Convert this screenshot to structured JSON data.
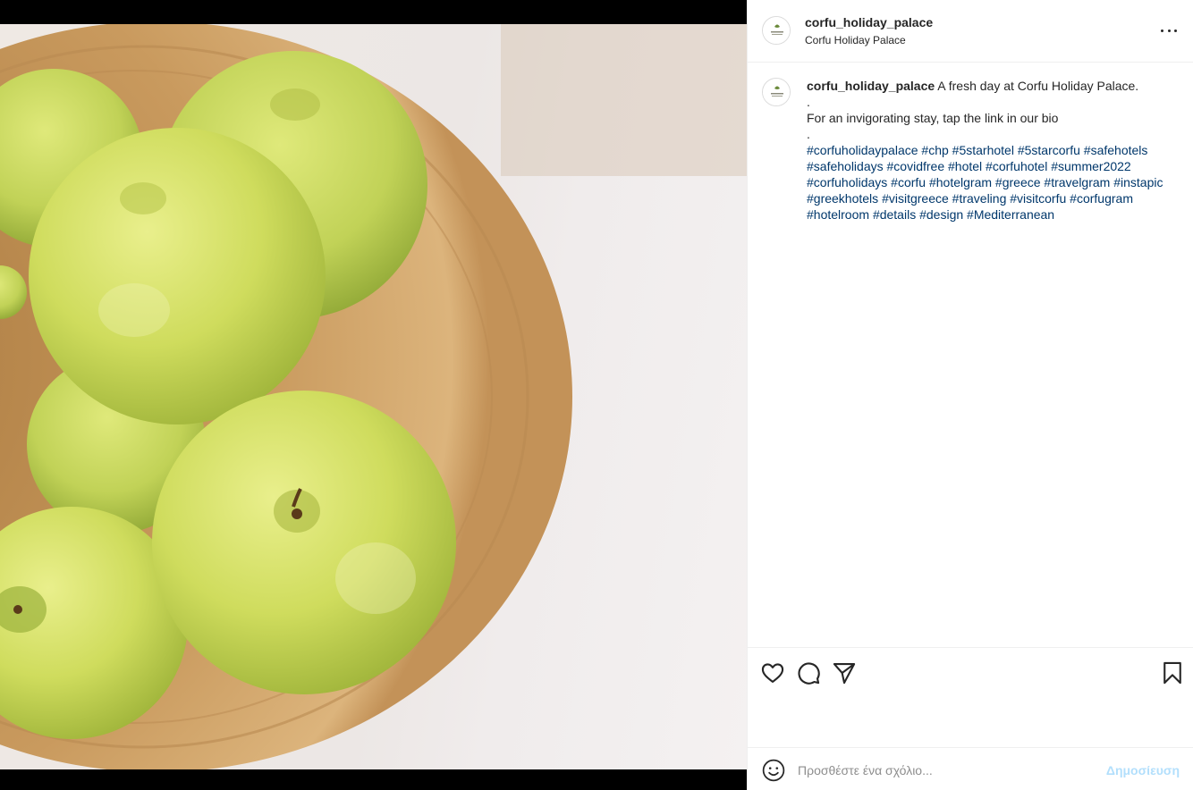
{
  "post": {
    "image_alt": "Green apples in a wooden bowl",
    "username": "corfu_holiday_palace",
    "location": "Corfu Holiday Palace",
    "avatar_icon": "hotel-logo-icon"
  },
  "caption": {
    "username": "corfu_holiday_palace",
    "lines": [
      "A fresh day at Corfu Holiday Palace.",
      ".",
      "For an invigorating stay, tap the link in our bio",
      "."
    ],
    "hashtags": [
      "#corfuholidaypalace",
      "#chp",
      "#5starhotel",
      "#5starcorfu",
      "#safehotels",
      "#safeholidays",
      "#covidfree",
      "#hotel",
      "#corfuhotel",
      "#summer2022",
      "#corfuholidays",
      "#corfu",
      "#hotelgram",
      "#greece",
      "#travelgram",
      "#instapic",
      "#greekhotels",
      "#visitgreece",
      "#traveling",
      "#visitcorfu",
      "#corfugram",
      "#hotelroom",
      "#details",
      "#design",
      "#Mediterranean"
    ]
  },
  "actions": {
    "like_icon": "heart-icon",
    "comment_icon": "comment-icon",
    "share_icon": "paper-plane-icon",
    "save_icon": "bookmark-icon"
  },
  "comment_box": {
    "placeholder": "Προσθέστε ένα σχόλιο...",
    "post_label": "Δημοσίευση",
    "post_color": "#b2dffc"
  },
  "colors": {
    "link": "#00376b",
    "border": "#efefef"
  }
}
